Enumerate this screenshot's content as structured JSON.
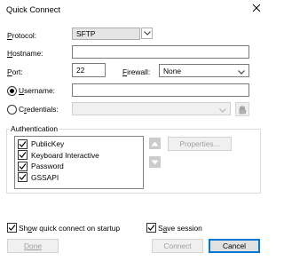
{
  "window": {
    "title": "Quick Connect"
  },
  "form": {
    "protocol_label": "Protocol:",
    "protocol_value": "SFTP",
    "hostname_label": "Hostname:",
    "hostname_value": "",
    "port_label": "Port:",
    "port_value": "22",
    "firewall_label": "Firewall:",
    "firewall_value": "None",
    "username_label": "Username:",
    "username_value": "",
    "credentials_label": "Credentials:",
    "credentials_value": ""
  },
  "auth": {
    "group_label": "Authentication",
    "methods": [
      {
        "label": "PublicKey",
        "checked": true
      },
      {
        "label": "Keyboard Interactive",
        "checked": true
      },
      {
        "label": "Password",
        "checked": true
      },
      {
        "label": "GSSAPI",
        "checked": true
      }
    ],
    "properties_label": "Properties..."
  },
  "options": {
    "show_quick_connect_label": "Show quick connect on startup",
    "save_session_label": "Save session"
  },
  "buttons": {
    "done": "Done",
    "connect": "Connect",
    "cancel": "Cancel"
  },
  "icons": {
    "close": "close-icon",
    "dropdown": "chevron-down-icon",
    "credentials": "credentials-icon",
    "up": "arrow-up-icon",
    "down": "arrow-down-icon",
    "check": "checkmark-icon"
  },
  "colors": {
    "window_bg": "#ffffff",
    "focus_blue": "#0078d7",
    "disabled_text": "#a0a0a0"
  }
}
